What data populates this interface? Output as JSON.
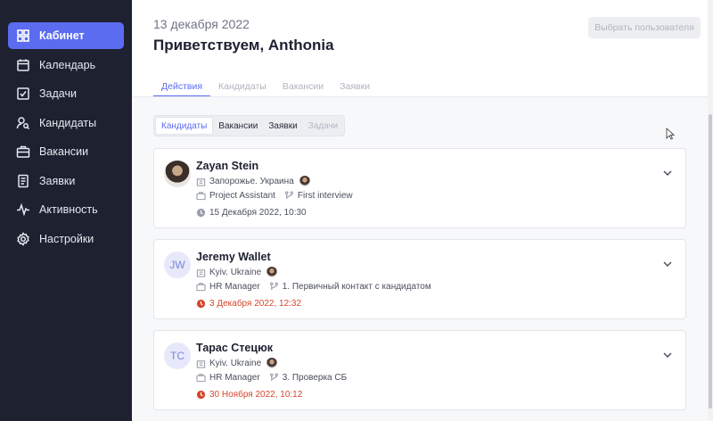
{
  "sidebar": {
    "items": [
      {
        "label": "Кабинет",
        "icon": "grid-icon"
      },
      {
        "label": "Календарь",
        "icon": "calendar-icon"
      },
      {
        "label": "Задачи",
        "icon": "checkbox-icon"
      },
      {
        "label": "Кандидаты",
        "icon": "user-search-icon"
      },
      {
        "label": "Вакансии",
        "icon": "briefcase-icon"
      },
      {
        "label": "Заявки",
        "icon": "document-icon"
      },
      {
        "label": "Активность",
        "icon": "activity-icon"
      },
      {
        "label": "Настройки",
        "icon": "gear-icon"
      }
    ]
  },
  "header": {
    "date": "13 декабря 2022",
    "greeting": "Приветствуем, Anthonia",
    "select_user": "Выбрать пользователя"
  },
  "tabs": [
    "Действия",
    "Кандидаты",
    "Вакансии",
    "Заявки"
  ],
  "segment": [
    "Кандидаты",
    "Вакансии",
    "Заявки",
    "Задачи"
  ],
  "cards": [
    {
      "initials": "",
      "name": "Zayan Stein",
      "location": "Запорожье. Украина",
      "position": "Project Assistant",
      "stage": "First interview",
      "datetime": "15 Декабря 2022, 10:30"
    },
    {
      "initials": "JW",
      "name": "Jeremy Wallet",
      "location": "Kyiv. Ukraine",
      "position": "HR Manager",
      "stage": "1. Первичный контакт с кандидатом",
      "datetime": "3 Декабря 2022, 12:32"
    },
    {
      "initials": "ТС",
      "name": "Тарас Стецюк",
      "location": "Kyiv. Ukraine",
      "position": "HR Manager",
      "stage": "3. Проверка СБ",
      "datetime": "30 Ноября 2022, 10:12"
    }
  ],
  "colors": {
    "sidebar_bg": "#1e2130",
    "accent": "#5b6cf0",
    "overdue": "#d6452b"
  }
}
